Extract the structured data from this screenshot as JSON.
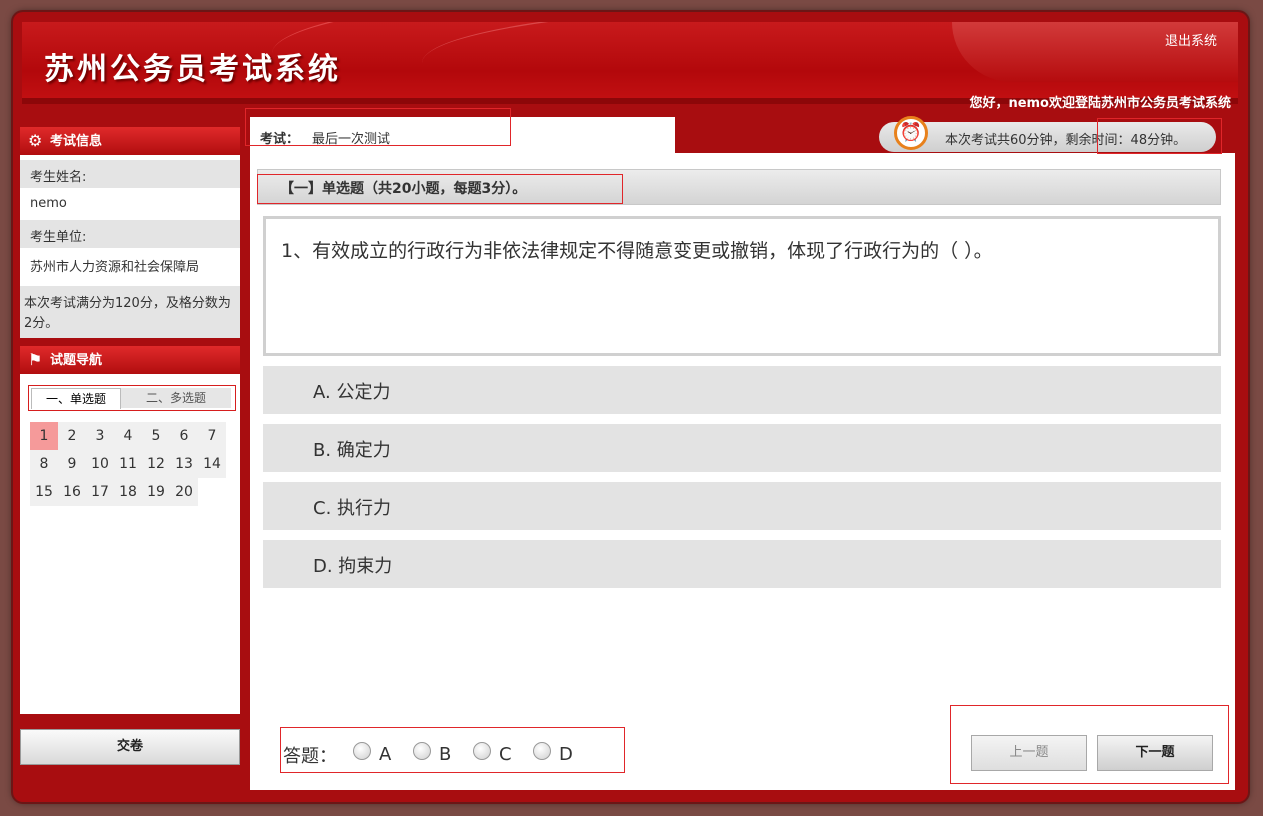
{
  "header": {
    "title": "苏州公务员考试系统",
    "logout": "退出系统",
    "welcome": "您好，nemo欢迎登陆苏州市公务员考试系统"
  },
  "exam_info": {
    "heading": "考试信息",
    "name_label": "考生姓名:",
    "name_value": "nemo",
    "unit_label": "考生单位:",
    "unit_value": "苏州市人力资源和社会保障局",
    "score_note": "本次考试满分为120分，及格分数为2分。"
  },
  "navigator": {
    "heading": "试题导航",
    "tabs": [
      "一、单选题",
      "二、多选题"
    ],
    "questions": [
      "1",
      "2",
      "3",
      "4",
      "5",
      "6",
      "7",
      "8",
      "9",
      "10",
      "11",
      "12",
      "13",
      "14",
      "15",
      "16",
      "17",
      "18",
      "19",
      "20"
    ],
    "current": "1"
  },
  "submit_label": "交卷",
  "exam": {
    "name_label": "考试：",
    "name_value": "最后一次测试",
    "timer_text": "本次考试共60分钟，剩余时间：48分钟。"
  },
  "section_title": "【一】单选题（共20小题，每题3分）。",
  "question": {
    "text": "1、有效成立的行政行为非依法律规定不得随意变更或撤销，体现了行政行为的（   ）。",
    "options": [
      "A. 公定力",
      "B. 确定力",
      "C. 执行力",
      "D. 拘束力"
    ]
  },
  "answer": {
    "label": "答题：",
    "choices": [
      "A",
      "B",
      "C",
      "D"
    ]
  },
  "buttons": {
    "prev": "上一题",
    "next": "下一题"
  },
  "colors": {
    "brand_red": "#b3080b",
    "current_question": "#f59a9a",
    "highlight_box": "#e0262a"
  },
  "icons": {
    "exam_info": "gear-icon",
    "navigator": "flag-icon",
    "timer": "alarm-clock-icon"
  }
}
